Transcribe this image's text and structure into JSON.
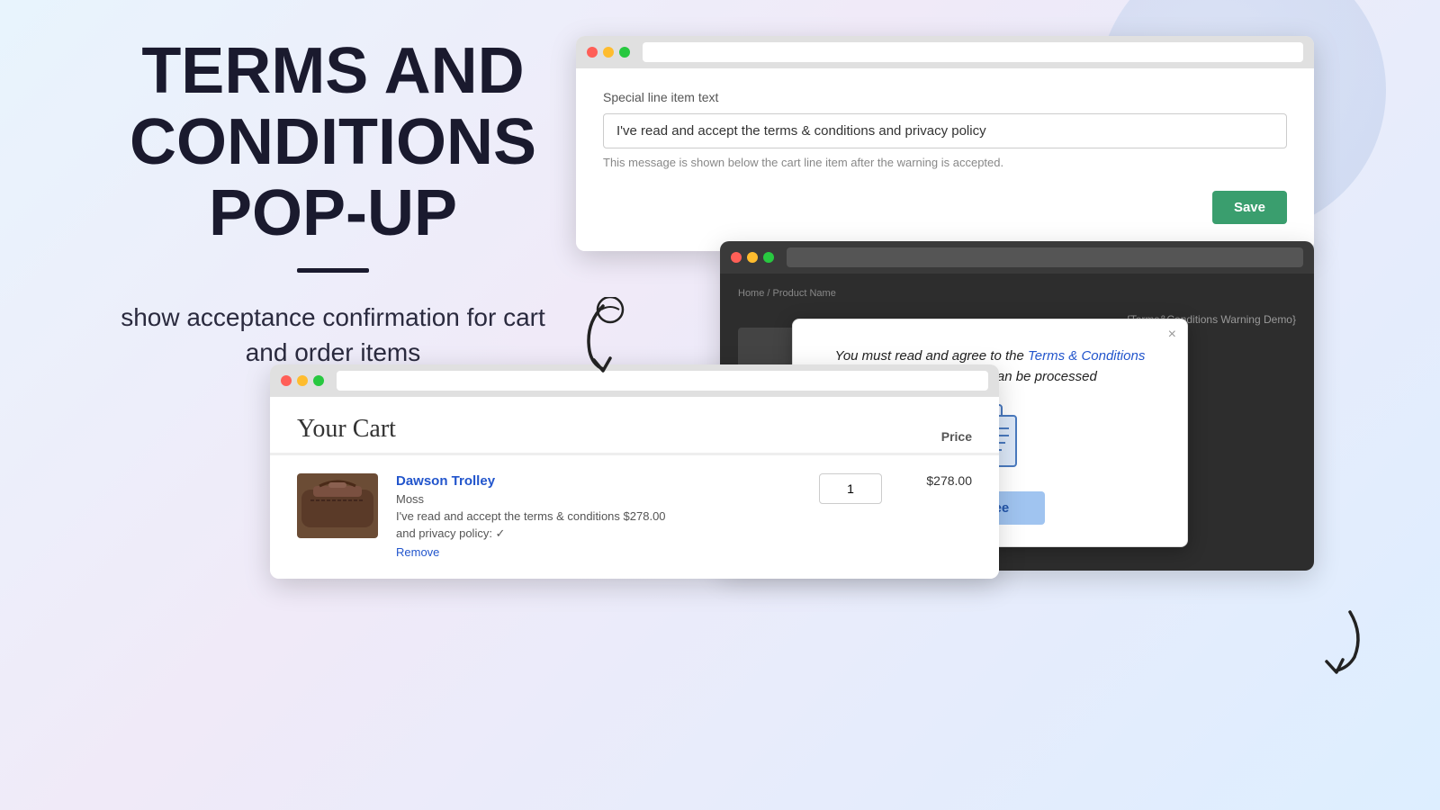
{
  "page": {
    "background": "gradient"
  },
  "left_panel": {
    "title_line1": "TERMS AND",
    "title_line2": "CONDITIONS",
    "title_line3": "POP-UP",
    "subtitle": "show acceptance confirmation for cart\nand order items"
  },
  "settings_window": {
    "titlebar": {
      "dots": [
        "red",
        "yellow",
        "green"
      ]
    },
    "label": "Special line item text",
    "input_value": "I've read and accept the terms & conditions and privacy policy",
    "hint": "This message is shown below the cart line item after the warning is accepted.",
    "save_button": "Save"
  },
  "popup_window": {
    "breadcrumb": "Home / Product Name",
    "title_bar": "{Terms&Conditions Warning Demo}",
    "modal": {
      "close_icon": "×",
      "text_before_link": "You must read and agree to the ",
      "link_text": "Terms & Conditions",
      "text_after_link": " before your order can be processed",
      "agree_button": "Agree"
    }
  },
  "cart_window": {
    "title": "Your Cart",
    "price_column": "Price",
    "item": {
      "name": "Dawson Trolley",
      "variant": "Moss",
      "terms_text": "I've read and accept the terms & conditions",
      "price_inline": "$278.00",
      "privacy_text": "and privacy policy: ✓",
      "quantity": "1",
      "total": "$278.00",
      "remove_link": "Remove"
    }
  },
  "arrows": {
    "arrow1_symbol": "↙",
    "arrow2_symbol": "↙"
  }
}
